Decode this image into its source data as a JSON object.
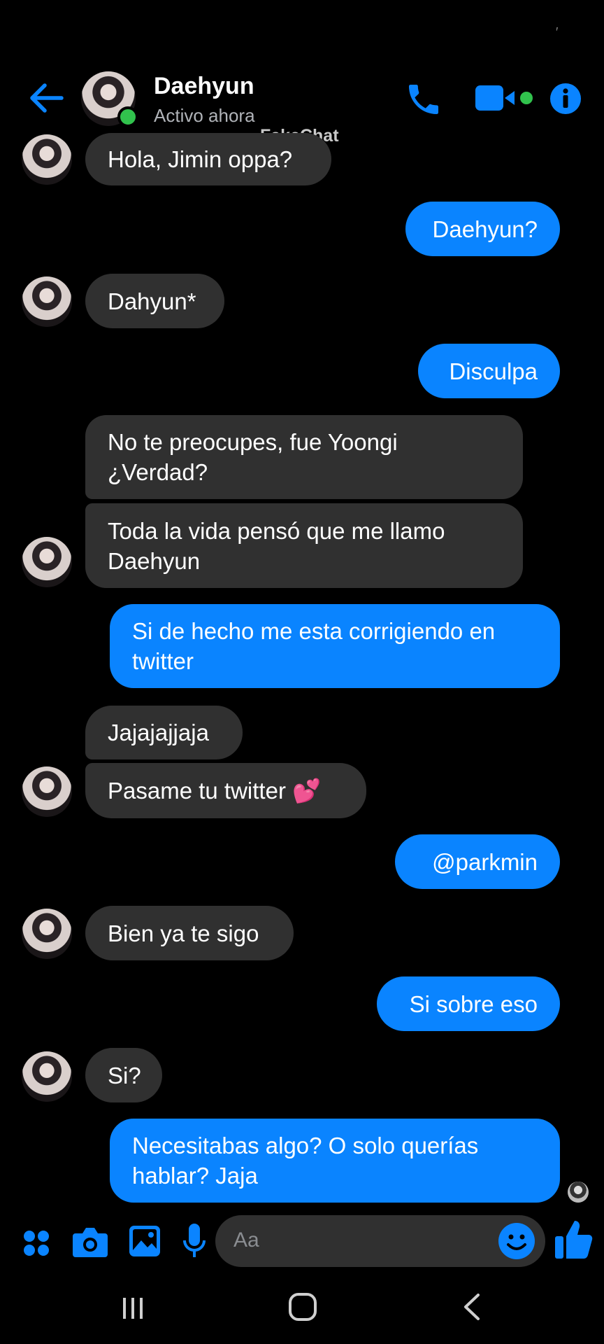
{
  "header": {
    "name": "Daehyun",
    "status": "Activo ahora",
    "watermark": "FakeChat",
    "colors": {
      "accent": "#0a84ff",
      "online": "#31c24d"
    }
  },
  "messages": [
    {
      "side": "in",
      "text": "Hola, Jimin oppa?"
    },
    {
      "side": "out",
      "text": "Daehyun?"
    },
    {
      "side": "in",
      "text": "Dahyun*"
    },
    {
      "side": "out",
      "text": "Disculpa"
    },
    {
      "side": "in",
      "line1": "No te preocupes, fue Yoongi",
      "line2": "¿Verdad?"
    },
    {
      "side": "in",
      "line1": "Toda la vida pensó que me llamo",
      "line2": "Daehyun"
    },
    {
      "side": "out",
      "line1": "Si de hecho me esta corrigiendo en",
      "line2": "twitter"
    },
    {
      "side": "in",
      "text": "Jajajajjaja"
    },
    {
      "side": "in",
      "text": "Pasame tu twitter 💕"
    },
    {
      "side": "out",
      "text": "@parkmin"
    },
    {
      "side": "in",
      "text": "Bien ya te sigo"
    },
    {
      "side": "out",
      "text": "Si sobre eso"
    },
    {
      "side": "in",
      "text": "Si?"
    },
    {
      "side": "out",
      "line1": "Necesitabas algo? O solo querías",
      "line2": "hablar? Jaja"
    }
  ],
  "composer": {
    "placeholder": "Aa",
    "icons": [
      "apps-icon",
      "camera-icon",
      "gallery-icon",
      "mic-icon",
      "emoji-icon",
      "like-icon"
    ]
  },
  "nav": {
    "icons": [
      "recents-icon",
      "home-icon",
      "back-nav-icon"
    ]
  }
}
